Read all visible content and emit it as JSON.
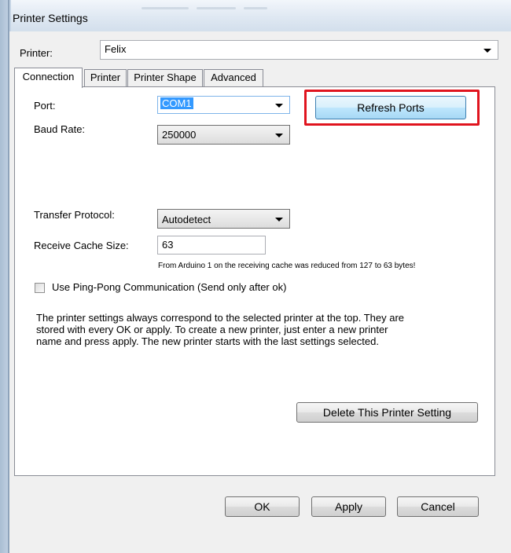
{
  "window": {
    "title": "Printer Settings"
  },
  "printer": {
    "label": "Printer:",
    "value": "Felix"
  },
  "tabs": [
    {
      "label": "Connection"
    },
    {
      "label": "Printer"
    },
    {
      "label": "Printer Shape"
    },
    {
      "label": "Advanced"
    }
  ],
  "connection": {
    "port_label": "Port:",
    "port_value": "COM1",
    "refresh_button": "Refresh Ports",
    "baud_label": "Baud Rate:",
    "baud_value": "250000",
    "protocol_label": "Transfer Protocol:",
    "protocol_value": "Autodetect",
    "cache_label": "Receive Cache Size:",
    "cache_value": "63",
    "cache_note": "From Arduino 1 on the receiving cache was reduced from 127 to 63 bytes!",
    "pingpong_label": "Use Ping-Pong Communication (Send only after ok)",
    "pingpong_checked": false,
    "info_text": "The printer settings always correspond to the selected printer at the top. They are stored with every OK or apply. To create a new printer, just enter a new printer name and press apply. The new printer starts with the last settings selected.",
    "delete_button": "Delete This Printer Setting"
  },
  "footer": {
    "ok": "OK",
    "apply": "Apply",
    "cancel": "Cancel"
  },
  "colors": {
    "highlight_box": "#e0141e",
    "selection": "#3399ff"
  }
}
